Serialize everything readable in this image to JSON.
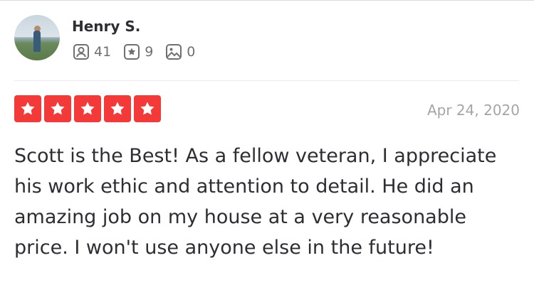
{
  "user": {
    "name": "Henry S.",
    "friends_count": "41",
    "reviews_count": "9",
    "photos_count": "0"
  },
  "review": {
    "rating": 5,
    "rating_max": 5,
    "date": "Apr 24, 2020",
    "text": "Scott is the Best! As a fellow veteran, I appreciate his work ethic and attention to detail. He did an amazing job on my house at a very reasonable price. I won't use anyone else in the future!"
  },
  "icons": {
    "friends": "friends-icon",
    "reviews": "review-star-icon",
    "photos": "photo-icon",
    "star": "star-icon"
  },
  "colors": {
    "star_fill": "#f43939",
    "text": "#2d2e33",
    "muted": "#6e7072",
    "date": "#a3a5a7"
  }
}
